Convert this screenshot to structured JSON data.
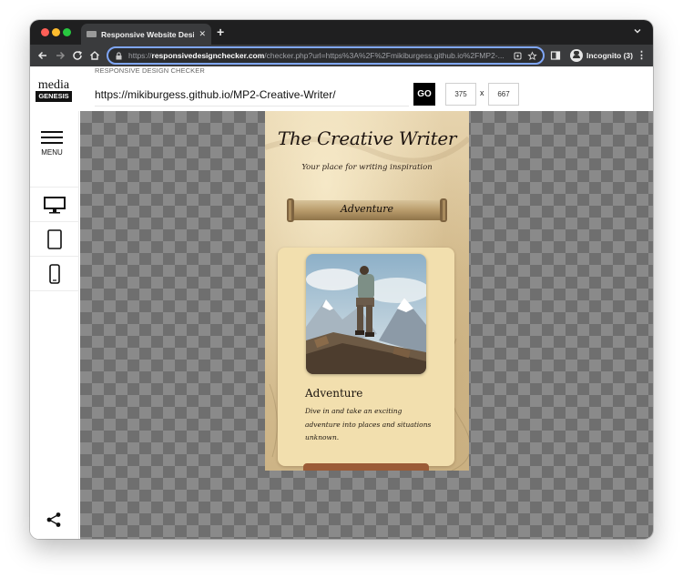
{
  "browser": {
    "tab_title": "Responsive Website Design Te",
    "tab_close": "✕",
    "new_tab": "+",
    "url_scheme": "https://",
    "url_host": "responsivedesignchecker.com",
    "url_rest": "/checker.php?url=https%3A%2F%2Fmikiburgess.github.io%2FMP2-...",
    "profile_label": "Incognito (3)",
    "menu_glyph": "⋮"
  },
  "app": {
    "header_label": "RESPONSIVE DESIGN CHECKER",
    "logo_top": "media",
    "logo_bottom": "GENESIS",
    "url_value": "https://mikiburgess.github.io/MP2-Creative-Writer/",
    "go_label": "GO",
    "width_value": "375",
    "x_label": "x",
    "height_value": "667",
    "menu_label": "MENU"
  },
  "site": {
    "title": "The Creative Writer",
    "tagline": "Your place for writing inspiration",
    "banner_label": "Adventure",
    "card_title": "Adventure",
    "card_text": "Dive in and take an exciting adventure into places and situations unknown."
  },
  "colors": {
    "tabstrip_bg": "#1f1f20",
    "toolbar_bg": "#3a3b3d",
    "omnibox_border": "#7fa6f7",
    "go_button_bg": "#000000",
    "site_bg": "#d8c194",
    "card_bg": "#f2dfae",
    "card_button": "#9b5b36"
  },
  "icons": {
    "sidebar_devices": [
      "desktop-icon",
      "tablet-icon",
      "phone-icon"
    ],
    "share": "share-icon"
  }
}
